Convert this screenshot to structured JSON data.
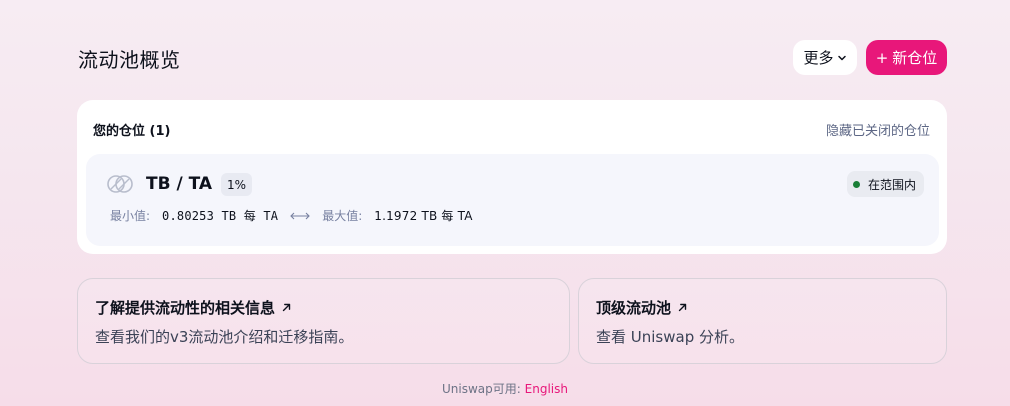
{
  "header": {
    "title": "流动池概览",
    "more_label": "更多",
    "new_position_label": "新仓位",
    "new_position_prefix": "+"
  },
  "positions": {
    "header": "您的仓位 (1)",
    "hide_closed_label": "隐藏已关闭的仓位",
    "items": [
      {
        "pair": "TB / TA",
        "fee": "1%",
        "status": "在范围内",
        "min_label": "最小值:",
        "min_value": "0.80253 TB 每 TA",
        "max_label": "最大值:",
        "max_value": "1.1972 TB 每 TA"
      }
    ]
  },
  "info_cards": [
    {
      "title": "了解提供流动性的相关信息",
      "description": "查看我们的v3流动池介绍和迁移指南。"
    },
    {
      "title": "顶级流动池",
      "description": "查看 Uniswap 分析。"
    }
  ],
  "footer": {
    "prefix": "Uniswap可用:",
    "language": "English"
  },
  "colors": {
    "accent": "#e8177a",
    "in_range_dot": "#1a7f37"
  },
  "icons": [
    "chevron-down-icon",
    "pair-token-icon",
    "double-arrow-icon",
    "external-link-icon"
  ]
}
